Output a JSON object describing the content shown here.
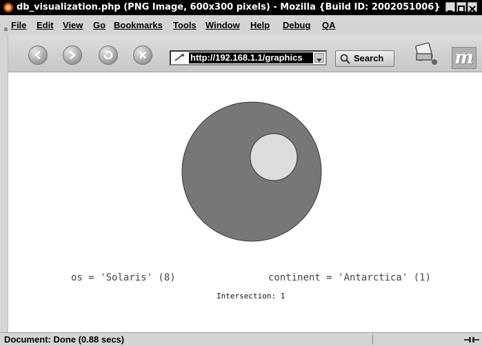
{
  "window": {
    "title": "db_visualization.php (PNG Image, 600x300 pixels) - Mozilla {Build ID: 2002051006}"
  },
  "menu": {
    "items": [
      {
        "label": "File"
      },
      {
        "label": "Edit"
      },
      {
        "label": "View"
      },
      {
        "label": "Go"
      },
      {
        "label": "Bookmarks"
      },
      {
        "label": "Tools"
      },
      {
        "label": "Window"
      },
      {
        "label": "Help"
      },
      {
        "label": "Debug"
      },
      {
        "label": "QA"
      }
    ]
  },
  "navigation": {
    "url": "http://192.168.1.1/graphics",
    "search_label": "Search",
    "buttons": {
      "back": "back-arrow-icon",
      "forward": "forward-arrow-icon",
      "reload": "reload-icon",
      "stop": "stop-icon"
    }
  },
  "visualization": {
    "left_set": "os = 'Solaris' (8)",
    "right_set": "continent = 'Antarctica' (1)",
    "intersection": "Intersection: 1",
    "colors": {
      "outer_circle": "#777777",
      "inner_circle": "#dddddd"
    }
  },
  "status": {
    "text": "Document: Done (0.88 secs)"
  },
  "colors": {
    "chrome": "#d4d4d4",
    "titlebar": "#000000"
  }
}
